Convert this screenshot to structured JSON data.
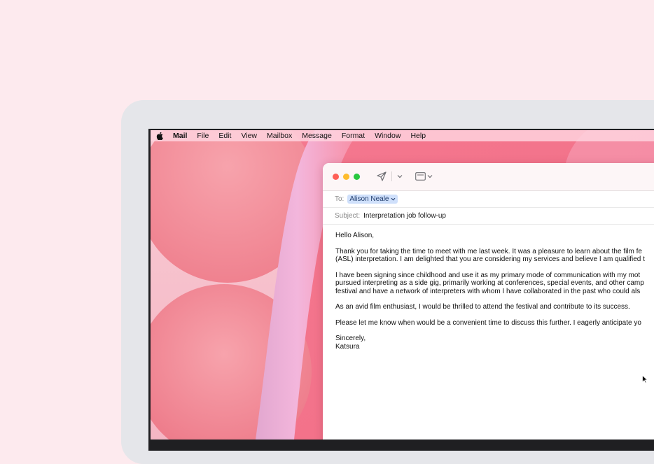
{
  "menubar": {
    "app_name": "Mail",
    "items": [
      "File",
      "Edit",
      "View",
      "Mailbox",
      "Message",
      "Format",
      "Window",
      "Help"
    ]
  },
  "toolbar": {
    "icons": [
      "send-icon",
      "chevron-down-icon",
      "format-bar-icon",
      "chevron-down-icon"
    ]
  },
  "compose": {
    "to_label": "To:",
    "recipient": "Alison Neale",
    "subject_label": "Subject:",
    "subject": "Interpretation job follow-up",
    "body": {
      "greeting": "Hello Alison,",
      "p1_line1": "Thank you for taking the time to meet with me last week. It was a pleasure to learn about the film fe",
      "p1_line2": "(ASL) interpretation. I am delighted that you are considering my services and believe I am qualified t",
      "p2_line1": "I have been signing since childhood and use it as my primary mode of communication with my mot",
      "p2_line2": "pursued interpreting as a side gig, primarily working at conferences, special events, and other camp",
      "p2_line3": "festival and have a network of interpreters with whom I have collaborated in the past who could als",
      "p3": "As an avid film enthusiast, I would be thrilled to attend the festival and contribute to its success.",
      "p4": "Please let me know when would be a convenient time to discuss this further. I eagerly anticipate yo",
      "closing": "Sincerely,",
      "signature": "Katsura"
    }
  },
  "colors": {
    "page_background": "#fdeaee",
    "token_background": "#cfe0fb",
    "traffic_red": "#fe5f57",
    "traffic_yellow": "#febc2e",
    "traffic_green": "#28c840"
  }
}
